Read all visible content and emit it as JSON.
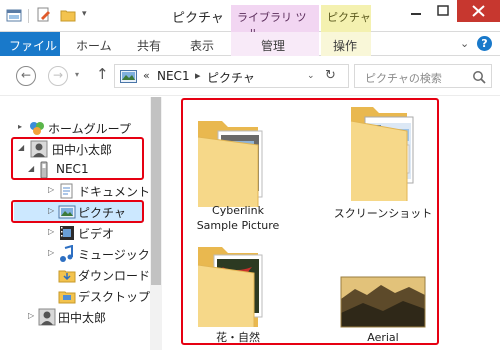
{
  "window": {
    "title": "ピクチャ",
    "context_tab_library": "ライブラリ ツール",
    "context_tab_picture": "ピクチャ ツール"
  },
  "ribbon": {
    "tabs": [
      "ファイル",
      "ホーム",
      "共有",
      "表示",
      "管理",
      "操作"
    ]
  },
  "address": {
    "overflow": "«",
    "segments": [
      "NEC1",
      "ピクチャ"
    ],
    "separator": "▸"
  },
  "search": {
    "placeholder": "ピクチャの検索"
  },
  "nav": {
    "items": [
      {
        "label": "ホームグループ",
        "icon": "homegroup-icon",
        "expander": "▸"
      },
      {
        "label": "田中小太郎",
        "icon": "user-icon",
        "expander": "◢"
      },
      {
        "label": "NEC1",
        "icon": "device-icon",
        "expander": "◢"
      },
      {
        "label": "ドキュメント",
        "icon": "documents-icon",
        "expander": "▷"
      },
      {
        "label": "ピクチャ",
        "icon": "pictures-icon",
        "expander": "▷"
      },
      {
        "label": "ビデオ",
        "icon": "videos-icon",
        "expander": "▷"
      },
      {
        "label": "ミュージック",
        "icon": "music-icon",
        "expander": "▷"
      },
      {
        "label": "ダウンロード",
        "icon": "downloads-icon",
        "expander": ""
      },
      {
        "label": "デスクトップ",
        "icon": "desktop-icon",
        "expander": ""
      },
      {
        "label": "田中太郎",
        "icon": "user-icon",
        "expander": "▷"
      }
    ]
  },
  "folders": [
    {
      "name_line1": "Cyberlink",
      "name_line2": "Sample Picture",
      "icon": "folder-photo-icon"
    },
    {
      "name_line1": "スクリーンショット",
      "name_line2": "",
      "icon": "folder-screenshot-icon"
    },
    {
      "name_line1": "花・自然",
      "name_line2": "",
      "icon": "folder-nature-icon"
    },
    {
      "name_line1": "Aerial",
      "name_line2": "",
      "icon": "folder-aerial-icon"
    }
  ],
  "colors": {
    "accent": "#1979ca",
    "highlight_frame": "#e60012",
    "selection": "#cce8ff",
    "folder": "#f3d17a"
  }
}
